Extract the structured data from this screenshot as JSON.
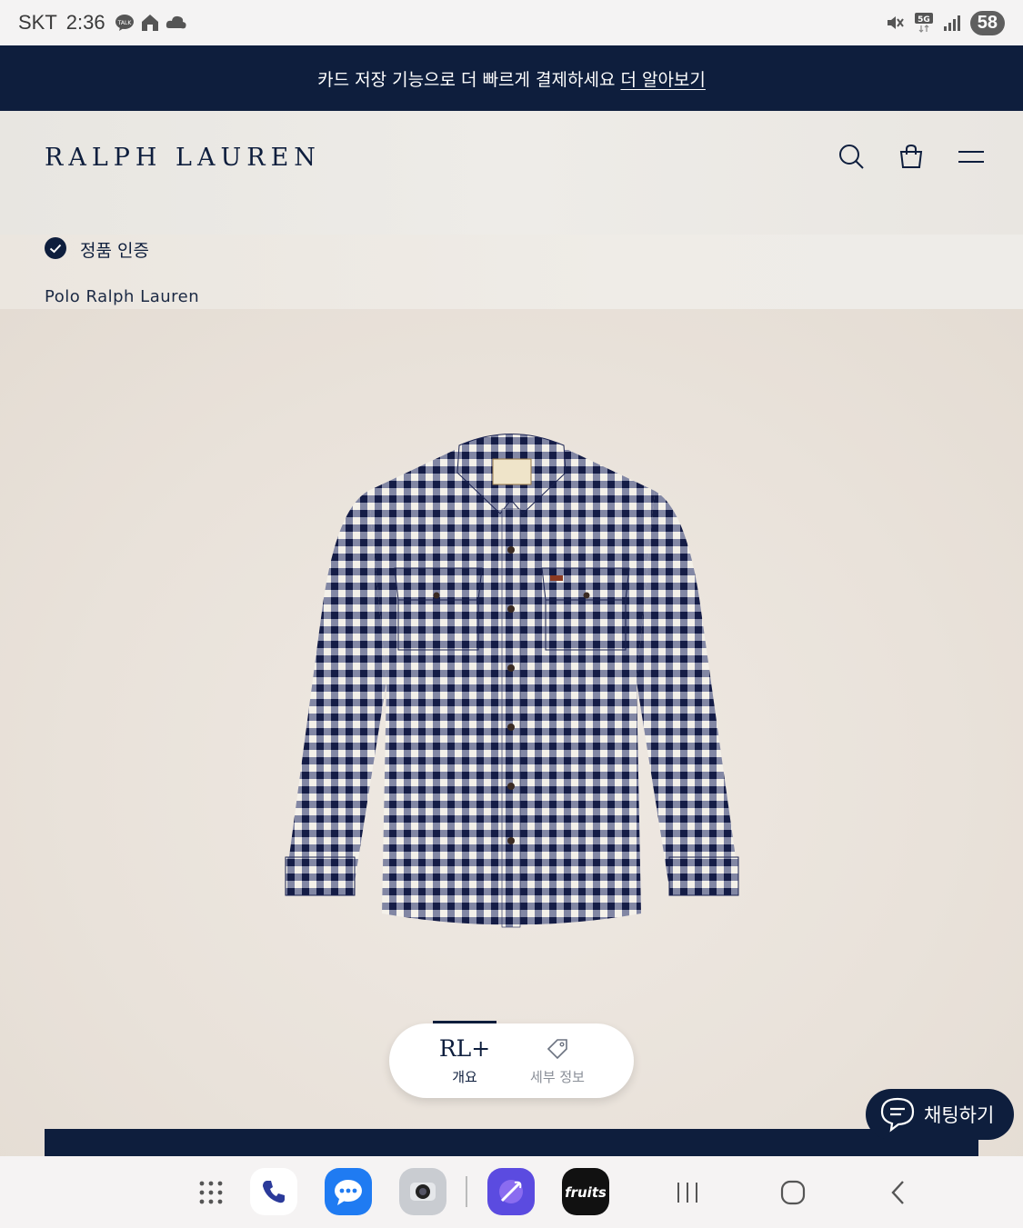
{
  "status_bar": {
    "carrier": "SKT",
    "time": "2:36",
    "network": "5G",
    "battery": "58"
  },
  "promo": {
    "text": "카드 저장 기능으로 더 빠르게 결제하세요",
    "link": "더 알아보기"
  },
  "header": {
    "logo": "RALPH LAUREN"
  },
  "product": {
    "auth_label": "정품 인증",
    "brand": "Polo Ralph Lauren"
  },
  "tabs": [
    {
      "mark": "RL+",
      "label": "개요"
    },
    {
      "label": "세부 정보"
    }
  ],
  "chat": {
    "label": "채팅하기"
  },
  "colors": {
    "navy": "#0e1e3d",
    "background": "#ede8e2"
  }
}
